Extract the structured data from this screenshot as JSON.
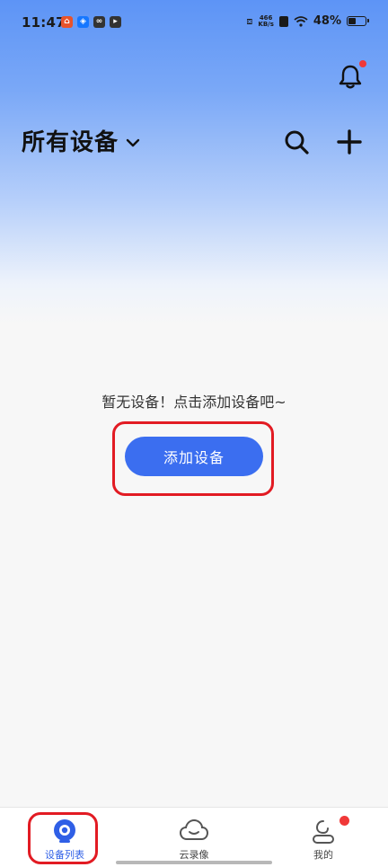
{
  "status_bar": {
    "time": "11:47",
    "net_speed_value": "466",
    "net_speed_unit": "KB/s",
    "battery": "48%",
    "battery_level": 0.48
  },
  "header": {
    "title": "所有设备"
  },
  "empty_state": {
    "message": "暂无设备！点击添加设备吧~",
    "add_button_label": "添加设备"
  },
  "bottom_nav": {
    "items": [
      {
        "label": "设备列表",
        "icon": "device-list-icon",
        "active": true
      },
      {
        "label": "云录像",
        "icon": "cloud-icon",
        "active": false
      },
      {
        "label": "我的",
        "icon": "profile-icon",
        "active": false
      }
    ]
  },
  "colors": {
    "accent": "#3b6ef0",
    "highlight": "#e21b23",
    "badge": "#f03838"
  }
}
